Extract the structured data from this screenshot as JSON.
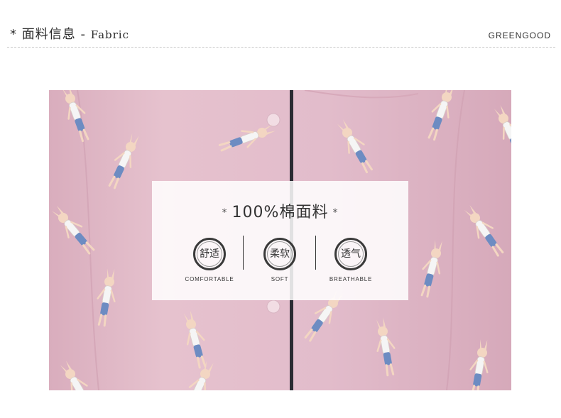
{
  "header": {
    "prefix": "*",
    "title_cn": "面料信息",
    "separator": "-",
    "title_en": "Fabric",
    "brand": "GREENGOOD"
  },
  "panel": {
    "star_left": "*",
    "headline": "100%棉面料",
    "star_right": "*",
    "features": [
      {
        "cn": "舒适",
        "en": "COMFORTABLE"
      },
      {
        "cn": "柔软",
        "en": "SOFT"
      },
      {
        "cn": "透气",
        "en": "BREATHABLE"
      }
    ]
  },
  "colors": {
    "fabric_pink": "#e3bcc9",
    "piping": "#2b2b33",
    "button": "#f2dde4"
  }
}
